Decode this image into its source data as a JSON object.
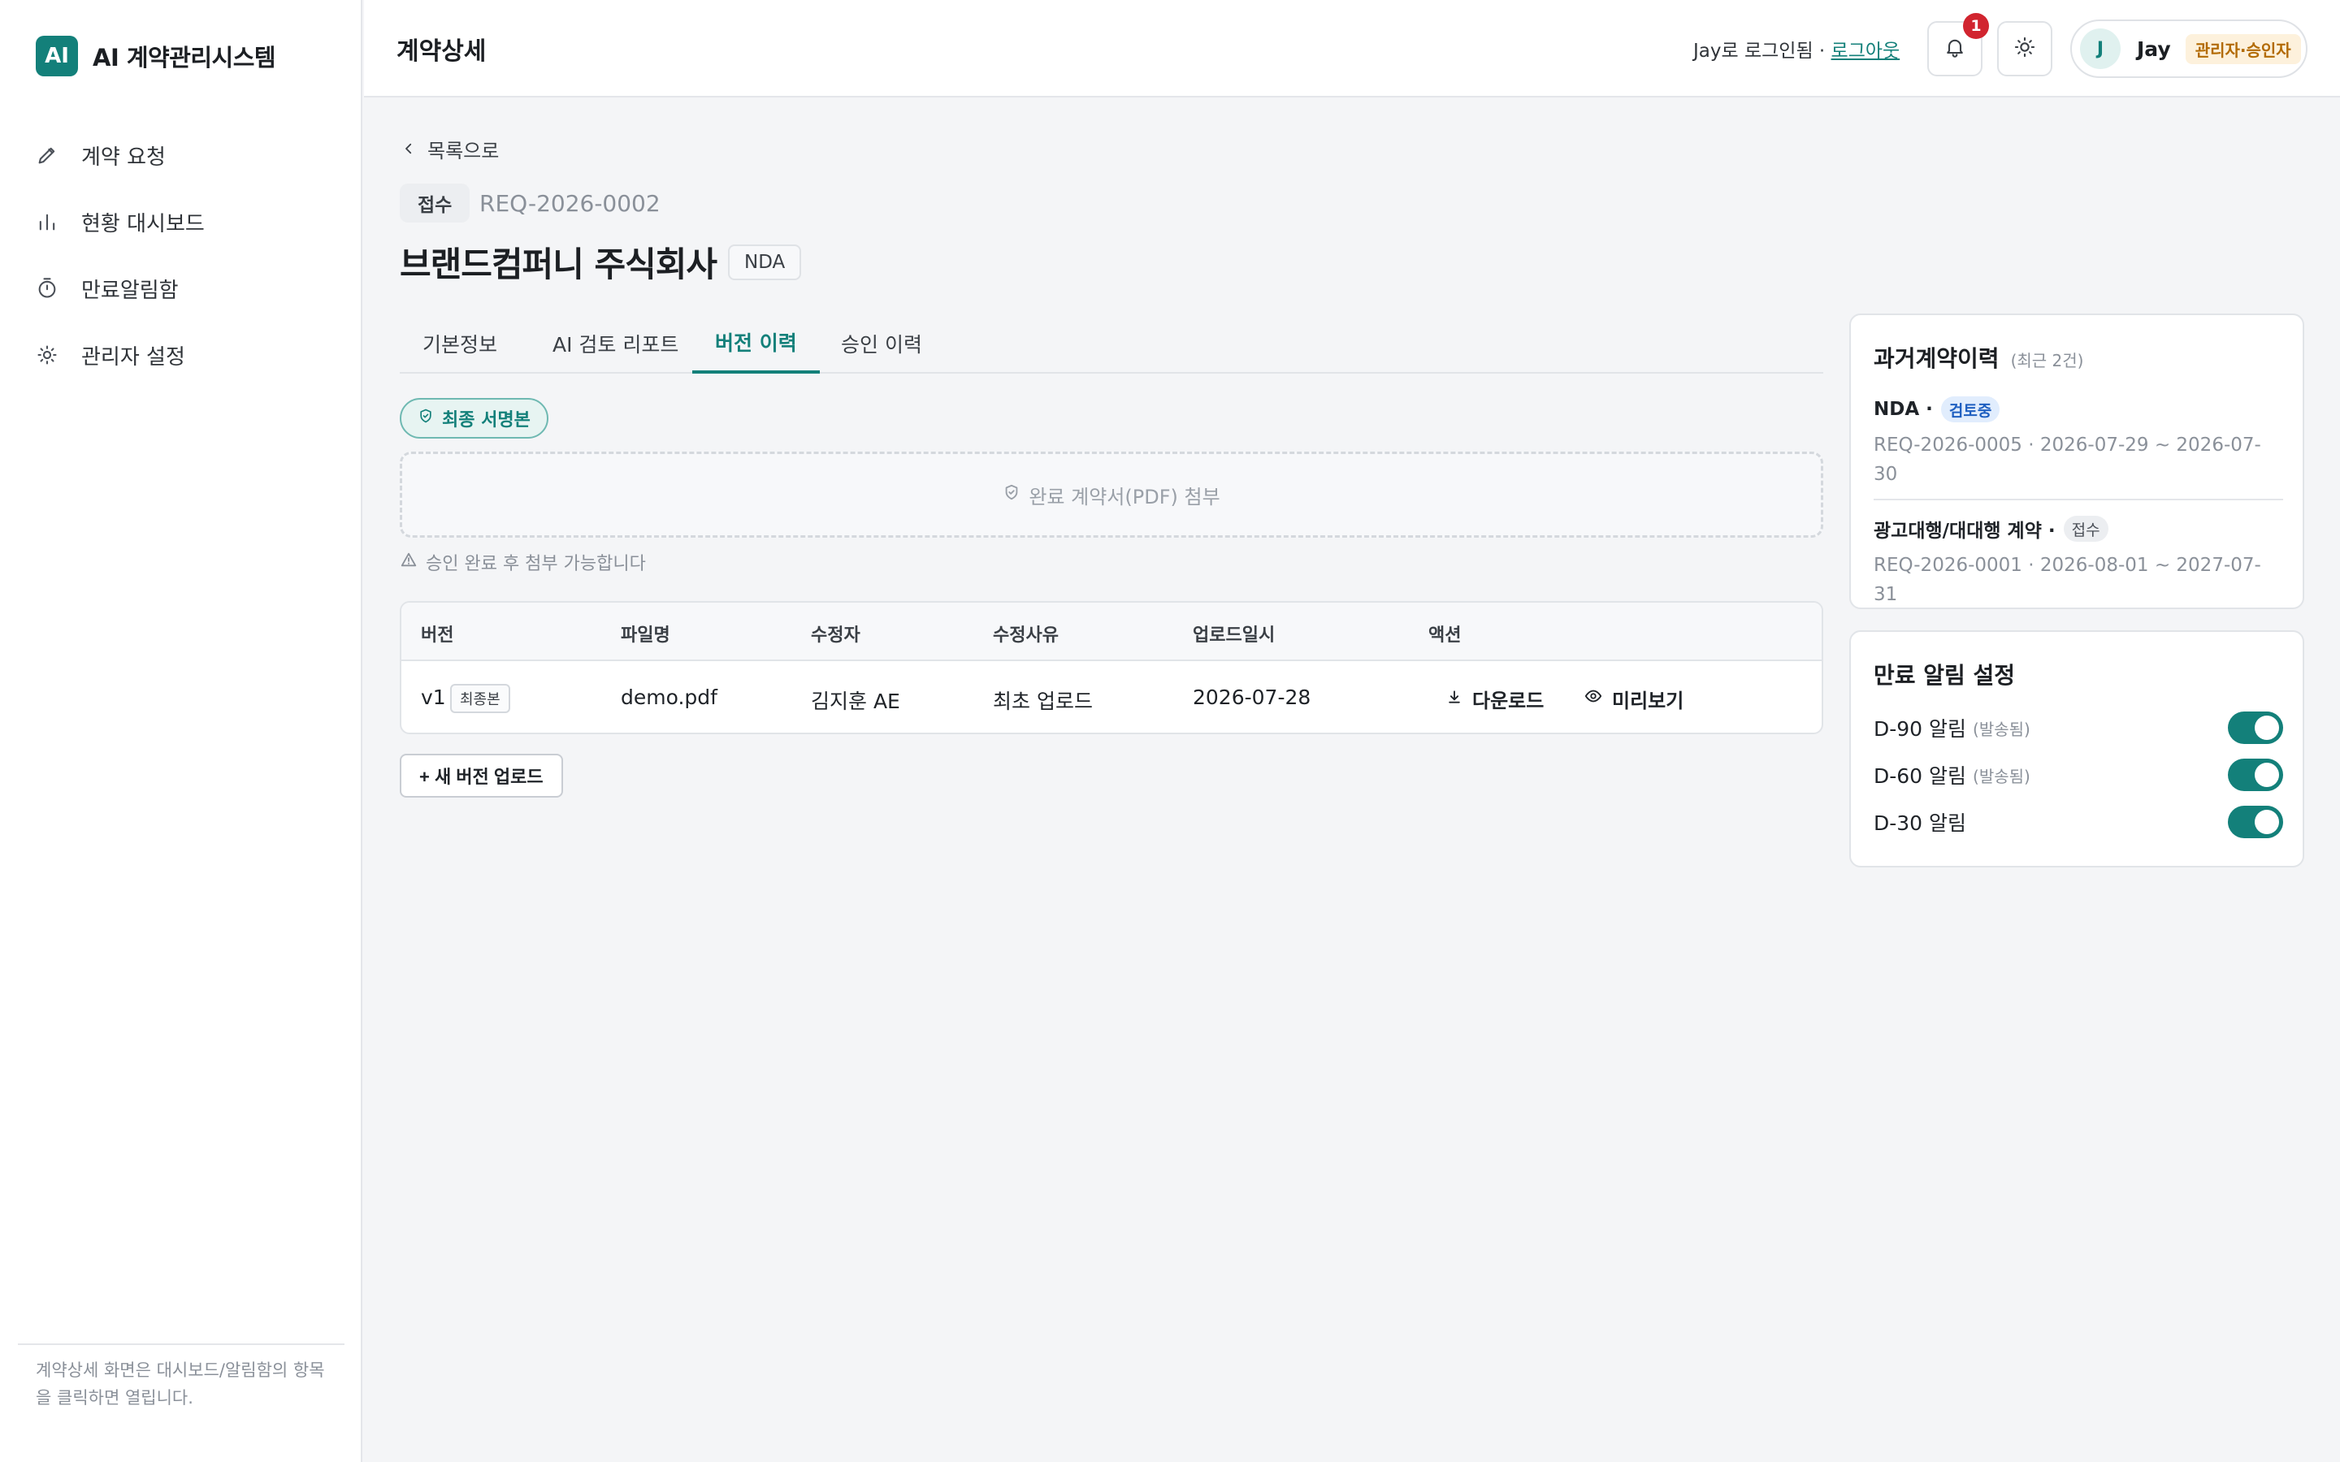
{
  "app": {
    "logo_text": "AI",
    "name": "AI 계약관리시스템"
  },
  "sidebar": {
    "items": [
      {
        "label": "계약 요청",
        "icon": "pencil-icon"
      },
      {
        "label": "현황 대시보드",
        "icon": "bar-chart-icon"
      },
      {
        "label": "만료알림함",
        "icon": "timer-icon"
      },
      {
        "label": "관리자 설정",
        "icon": "sun-gear-icon"
      }
    ],
    "note": "계약상세 화면은 대시보드/알림함의 항목을 클릭하면 열립니다."
  },
  "header": {
    "title": "계약상세",
    "login_text": "Jay로 로그인됨 · ",
    "logout_label": "로그아웃",
    "notification_count": "1",
    "user": {
      "avatar_initial": "J",
      "name": "Jay",
      "role": "관리자·승인자"
    }
  },
  "contract": {
    "back_label": "목록으로",
    "status": "접수",
    "request_id": "REQ-2026-0002",
    "company": "브랜드컴퍼니 주식회사",
    "type": "NDA"
  },
  "tabs": [
    {
      "label": "기본정보",
      "active": false
    },
    {
      "label": "AI 검토 리포트",
      "active": false
    },
    {
      "label": "버전 이력",
      "active": true
    },
    {
      "label": "승인 이력",
      "active": false
    }
  ],
  "versions": {
    "final_badge": "최종 서명본",
    "dropzone_text": "완료 계약서(PDF) 첨부",
    "attach_note": "승인 완료 후 첨부 가능합니다",
    "columns": [
      "버전",
      "파일명",
      "수정자",
      "수정사유",
      "업로드일시",
      "액션"
    ],
    "rows": [
      {
        "version": "v1",
        "version_tag": "최종본",
        "file": "demo.pdf",
        "editor": "김지훈 AE",
        "reason": "최초 업로드",
        "uploaded": "2026-07-28",
        "download_label": "다운로드",
        "preview_label": "미리보기"
      }
    ],
    "upload_button": "+ 새 버전 업로드"
  },
  "history_panel": {
    "title": "과거계약이력",
    "subtitle": "(최근 2건)",
    "items": [
      {
        "type": "NDA ·",
        "status": "검토중",
        "meta": "REQ-2026-0005 · 2026-07-29 ~ 2026-07-30"
      },
      {
        "type": "광고대행/대대행 계약 ·",
        "status": "접수",
        "meta": "REQ-2026-0001 · 2026-08-01 ~ 2027-07-31"
      }
    ]
  },
  "alerts_panel": {
    "title": "만료 알림 설정",
    "items": [
      {
        "label": "D-90 알림",
        "sub": "(발송됨)",
        "on": true
      },
      {
        "label": "D-60 알림",
        "sub": "(발송됨)",
        "on": true
      },
      {
        "label": "D-30 알림",
        "sub": "",
        "on": true
      }
    ]
  },
  "colors": {
    "accent": "#13807a",
    "badge_red": "#d1242f",
    "role_orange": "#b26a00",
    "status_blue": "#1e5fc0"
  }
}
